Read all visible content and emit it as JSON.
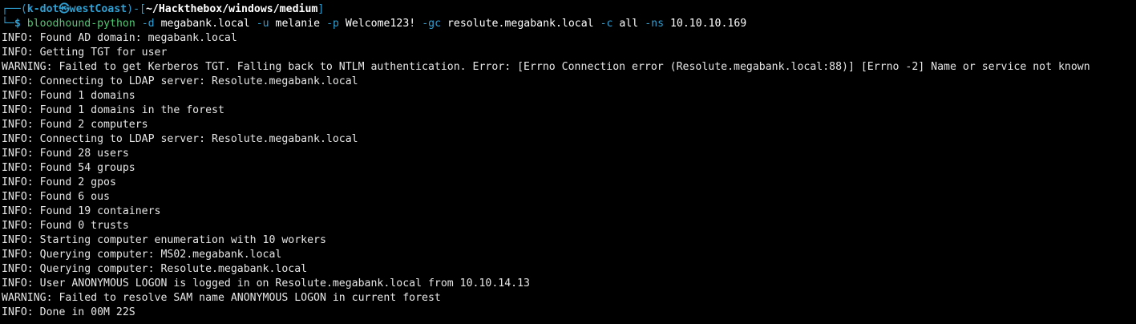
{
  "prompt": {
    "corner_top": "┌──(",
    "user": "k-dot",
    "at_symbol": "㉿",
    "host": "westCoast",
    "mid": ")-[",
    "path": "~/Hackthebox/windows/medium",
    "close": "]",
    "corner_bottom": "└─",
    "dollar": "$"
  },
  "command": {
    "program": "bloodhound-python",
    "tokens": [
      {
        "text": "-d",
        "kind": "flag"
      },
      {
        "text": "megabank.local",
        "kind": "arg"
      },
      {
        "text": "-u",
        "kind": "flag"
      },
      {
        "text": "melanie",
        "kind": "arg"
      },
      {
        "text": "-p",
        "kind": "flag"
      },
      {
        "text": "Welcome123!",
        "kind": "arg"
      },
      {
        "text": "-gc",
        "kind": "flag"
      },
      {
        "text": "resolute.megabank.local",
        "kind": "arg"
      },
      {
        "text": "-c",
        "kind": "flag"
      },
      {
        "text": "all",
        "kind": "arg"
      },
      {
        "text": "-ns",
        "kind": "flag"
      },
      {
        "text": "10.10.10.169",
        "kind": "arg"
      }
    ]
  },
  "output": [
    "INFO: Found AD domain: megabank.local",
    "INFO: Getting TGT for user",
    "WARNING: Failed to get Kerberos TGT. Falling back to NTLM authentication. Error: [Errno Connection error (Resolute.megabank.local:88)] [Errno -2] Name or service not known",
    "INFO: Connecting to LDAP server: Resolute.megabank.local",
    "INFO: Found 1 domains",
    "INFO: Found 1 domains in the forest",
    "INFO: Found 2 computers",
    "INFO: Connecting to LDAP server: Resolute.megabank.local",
    "INFO: Found 28 users",
    "INFO: Found 54 groups",
    "INFO: Found 2 gpos",
    "INFO: Found 6 ous",
    "INFO: Found 19 containers",
    "INFO: Found 0 trusts",
    "INFO: Starting computer enumeration with 10 workers",
    "INFO: Querying computer: MS02.megabank.local",
    "INFO: Querying computer: Resolute.megabank.local",
    "INFO: User ANONYMOUS LOGON is logged in on Resolute.megabank.local from 10.10.14.13",
    "WARNING: Failed to resolve SAM name ANONYMOUS LOGON in current forest",
    "INFO: Done in 00M 22S"
  ],
  "colors": {
    "background": "#000000",
    "prompt_blue": "#2f9fd2",
    "command_green": "#52c873",
    "text": "#e6e6e6"
  }
}
